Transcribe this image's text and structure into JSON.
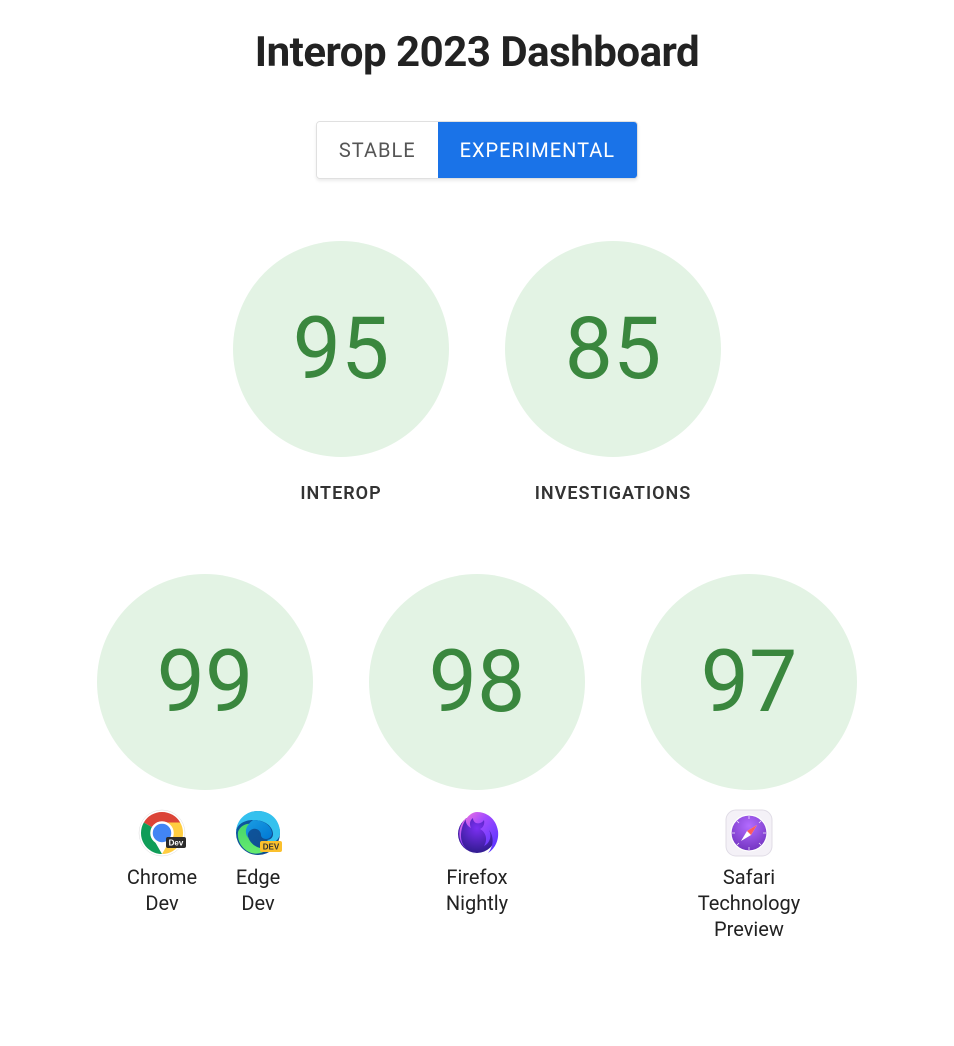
{
  "title": "Interop 2023 Dashboard",
  "tabs": {
    "stable": "Stable",
    "experimental": "Experimental",
    "active": "experimental"
  },
  "summary": [
    {
      "value": "95",
      "label": "Interop"
    },
    {
      "value": "85",
      "label": "Investigations"
    }
  ],
  "browsers": [
    {
      "value": "99",
      "labels": [
        {
          "icon": "chrome-dev-icon",
          "name": "Chrome\nDev"
        },
        {
          "icon": "edge-dev-icon",
          "name": "Edge\nDev"
        }
      ]
    },
    {
      "value": "98",
      "labels": [
        {
          "icon": "firefox-nightly-icon",
          "name": "Firefox\nNightly"
        }
      ]
    },
    {
      "value": "97",
      "labels": [
        {
          "icon": "safari-tp-icon",
          "name": "Safari\nTechnology\nPreview"
        }
      ]
    }
  ]
}
